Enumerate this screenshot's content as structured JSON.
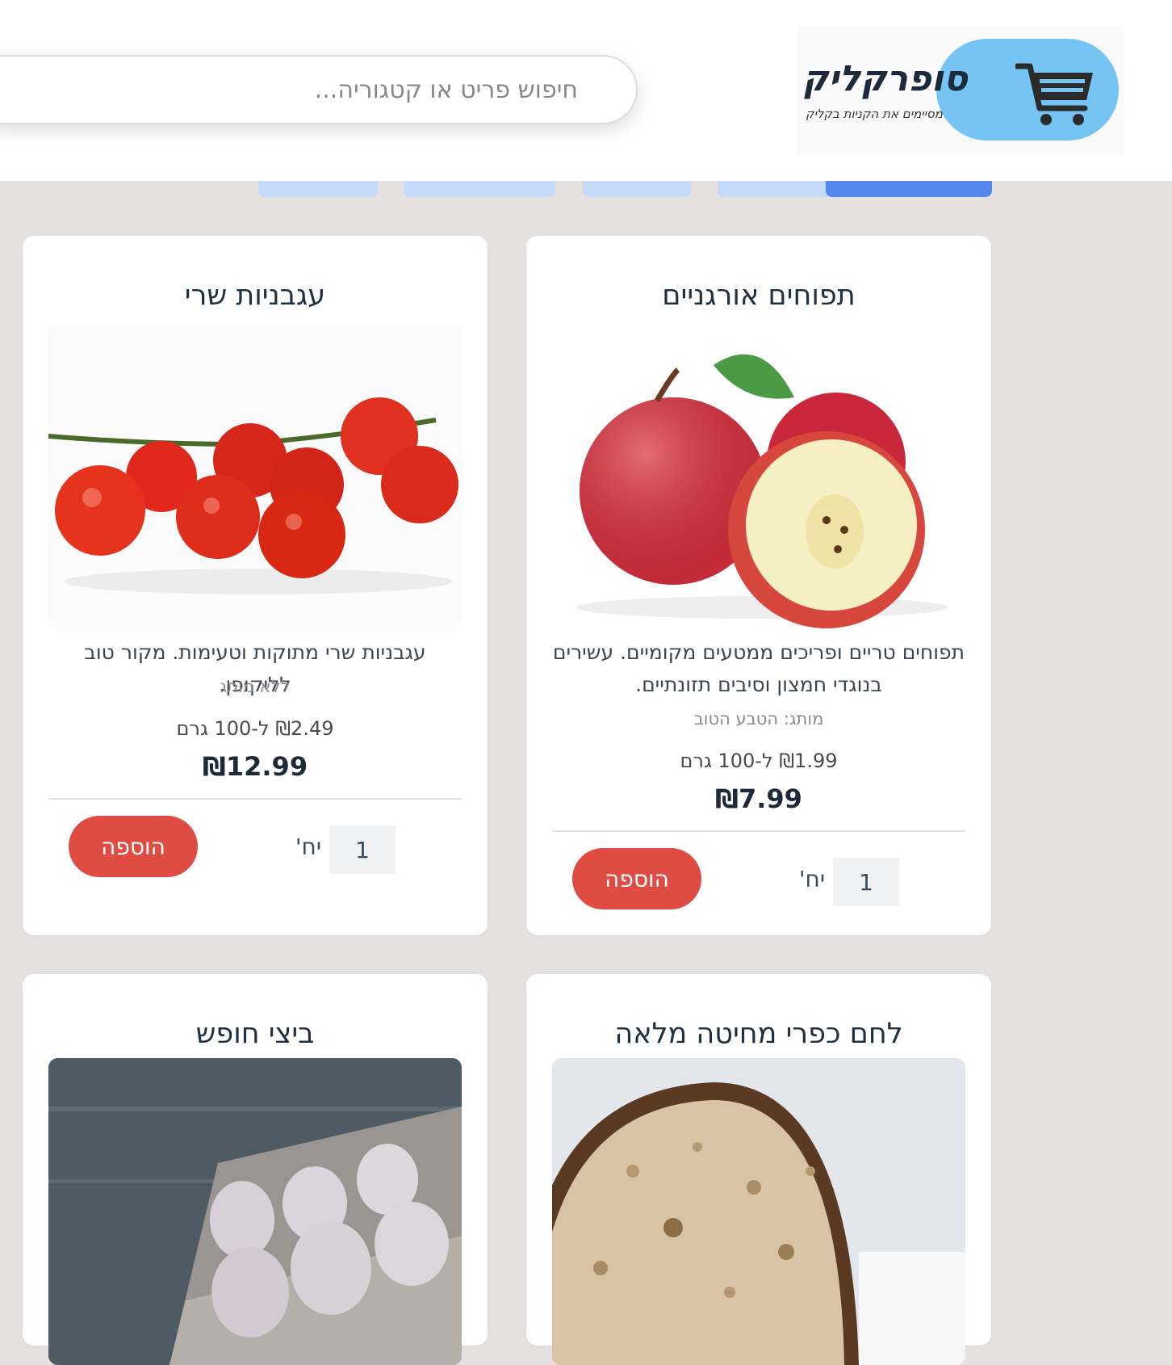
{
  "header": {
    "search_placeholder": "חיפוש פריט או קטגוריה...",
    "brand_name": "סופרקליק",
    "brand_tagline": "מסיימים את הקניות בקליק",
    "cart_icon": "shopping-cart-icon"
  },
  "colors": {
    "accent_blue": "#5388ea",
    "tab_light": "#c4daf8",
    "cart_bg": "#76c4f4",
    "add_button": "#df4c43",
    "page_bg": "#e5e1e0"
  },
  "products": [
    {
      "title": "תפוחים אורגניים",
      "description": "תפוחים טריים ופריכים ממטעים מקומיים. עשירים בנוגדי חמצון וסיבים תזונתיים.",
      "brand": "מותג: הטבע הטוב",
      "unit_price": "₪1.99 ל-100 גרם",
      "price": "₪7.99",
      "quantity": "1",
      "qty_unit": "יח'",
      "add_label": "הוספה",
      "image": "apples-photo"
    },
    {
      "title": "עגבניות שרי",
      "description": "עגבניות שרי מתוקות וטעימות. מקור טוב לליקופן.",
      "brand": "ללא מותג",
      "unit_price": "₪2.49 ל-100 גרם",
      "price": "₪12.99",
      "quantity": "1",
      "qty_unit": "יח'",
      "add_label": "הוספה",
      "image": "cherry-tomatoes-photo"
    },
    {
      "title": "לחם כפרי מחיטה מלאה",
      "image": "bread-photo"
    },
    {
      "title": "ביצי חופש",
      "image": "eggs-photo"
    }
  ]
}
